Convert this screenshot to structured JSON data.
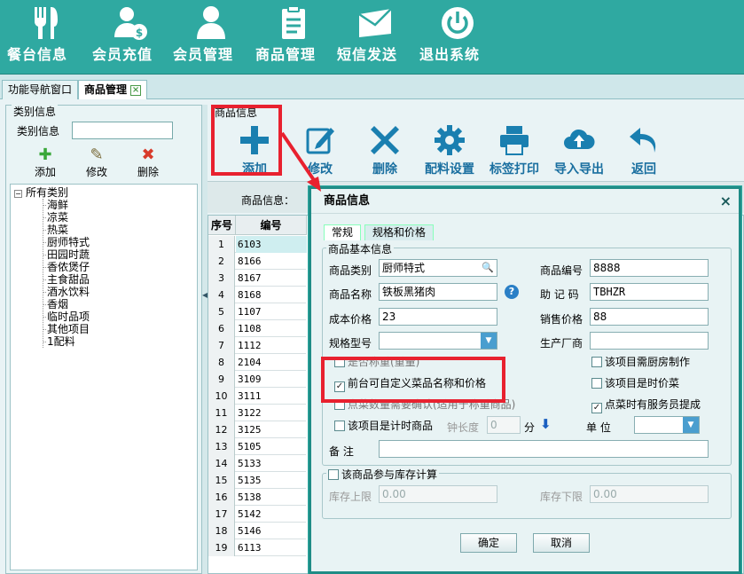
{
  "toolbar": {
    "items": [
      {
        "label": "餐台信息",
        "icon": "fork-knife-icon"
      },
      {
        "label": "会员充值",
        "icon": "member-recharge-icon"
      },
      {
        "label": "会员管理",
        "icon": "user-icon"
      },
      {
        "label": "商品管理",
        "icon": "clipboard-icon"
      },
      {
        "label": "短信发送",
        "icon": "envelope-icon"
      },
      {
        "label": "退出系统",
        "icon": "power-icon"
      }
    ]
  },
  "tabs": [
    {
      "label": "功能导航窗口"
    },
    {
      "label": "商品管理",
      "close": "×"
    }
  ],
  "left": {
    "group_title": "类别信息",
    "search_label": "类别信息",
    "search_value": "",
    "buttons": [
      {
        "label": "添加",
        "icon": "plus-icon"
      },
      {
        "label": "修改",
        "icon": "edit-icon"
      },
      {
        "label": "删除",
        "icon": "delete-icon"
      }
    ],
    "tree_root": "所有类别",
    "tree_items": [
      "海鲜",
      "凉菜",
      "热菜",
      "厨师特式",
      "田园时蔬",
      "香侬煲仔",
      "主食甜品",
      "酒水饮料",
      "香烟",
      "临时品项",
      "其他项目",
      "1配料"
    ]
  },
  "right": {
    "group_title": "商品信息",
    "toolbar": [
      {
        "label": "添加",
        "icon": "plus-icon"
      },
      {
        "label": "修改",
        "icon": "edit-icon"
      },
      {
        "label": "删除",
        "icon": "delete-icon"
      },
      {
        "label": "配料设置",
        "icon": "gear-icon"
      },
      {
        "label": "标签打印",
        "icon": "printer-icon"
      },
      {
        "label": "导入导出",
        "icon": "cloud-icon"
      },
      {
        "label": "返回",
        "icon": "back-icon"
      }
    ],
    "search_label": "商品信息：",
    "grid": {
      "headers": [
        "序号",
        "编号"
      ],
      "rows": [
        {
          "idx": "1",
          "code": "6103"
        },
        {
          "idx": "2",
          "code": "8166"
        },
        {
          "idx": "3",
          "code": "8167"
        },
        {
          "idx": "4",
          "code": "8168"
        },
        {
          "idx": "5",
          "code": "1107"
        },
        {
          "idx": "6",
          "code": "1108"
        },
        {
          "idx": "7",
          "code": "1112"
        },
        {
          "idx": "8",
          "code": "2104"
        },
        {
          "idx": "9",
          "code": "3109"
        },
        {
          "idx": "10",
          "code": "3111"
        },
        {
          "idx": "11",
          "code": "3122"
        },
        {
          "idx": "12",
          "code": "3125"
        },
        {
          "idx": "13",
          "code": "5105"
        },
        {
          "idx": "14",
          "code": "5133"
        },
        {
          "idx": "15",
          "code": "5135"
        },
        {
          "idx": "16",
          "code": "5138"
        },
        {
          "idx": "17",
          "code": "5142"
        },
        {
          "idx": "18",
          "code": "5146"
        },
        {
          "idx": "19",
          "code": "6113"
        }
      ]
    }
  },
  "dialog": {
    "title": "商品信息",
    "close": "×",
    "tabs": [
      "常规",
      "规格和价格"
    ],
    "basic_title": "商品基本信息",
    "fields": {
      "category_label": "商品类别",
      "category_value": "厨师特式",
      "code_label": "商品编号",
      "code_value": "8888",
      "name_label": "商品名称",
      "name_value": "铁板黑猪肉",
      "mnemonic_label": "助 记 码",
      "mnemonic_value": "TBHZR",
      "cost_label": "成本价格",
      "cost_value": "23",
      "price_label": "销售价格",
      "price_value": "88",
      "spec_label": "规格型号",
      "spec_value": "",
      "maker_label": "生产厂商",
      "maker_value": "",
      "duration_label": "钟长度",
      "duration_value": "0",
      "duration_unit": "分",
      "unit_label": "单 位",
      "unit_value": "",
      "remark_label": "备 注",
      "remark_value": ""
    },
    "checks": {
      "weighted": "是否称重(重量)",
      "kitchen": "该项目需厨房制作",
      "custom": "前台可自定义菜品名称和价格",
      "timeprice": "该项目是时价菜",
      "confirm": "点菜数量需要确认(适用于称重商品)",
      "commission": "点菜时有服务员提成",
      "timed": "该项目是计时商品"
    },
    "stock_title": "该商品参与库存计算",
    "stock_upper_label": "库存上限",
    "stock_upper_value": "0.00",
    "stock_lower_label": "库存下限",
    "stock_lower_value": "0.00",
    "ok": "确定",
    "cancel": "取消"
  },
  "colors": {
    "accent": "#2fa9a1",
    "highlight": "#e8212f",
    "button_text": "#1a6fa0"
  }
}
